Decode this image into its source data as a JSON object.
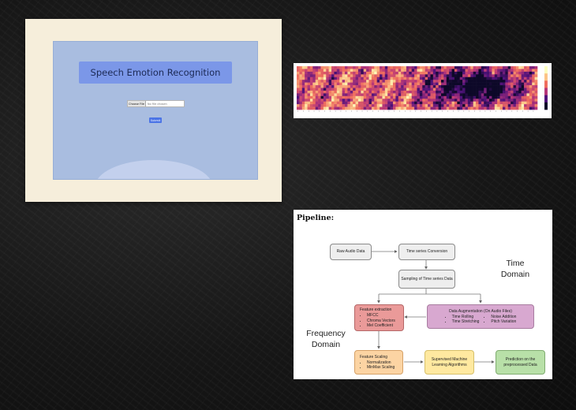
{
  "app_screenshot": {
    "title": "Speech Emotion Recognition",
    "file_button_label": "Choose File",
    "file_status": "No file chosen",
    "submit_label": "Submit",
    "colors": {
      "card_bg": "#f6eedb",
      "screen_bg": "#a9bde0",
      "title_bg": "#7b97e8",
      "button_bg": "#4b74e6"
    }
  },
  "heatmap": {
    "colormap": "magma",
    "colorbar": true
  },
  "pipeline": {
    "title": "Pipeline:",
    "nodes": {
      "raw_audio": "Raw Audio Data",
      "time_series": "Time series Conversion",
      "sampling": "Sampling of Time series Data",
      "feature_extraction": {
        "title": "Feature extraction",
        "items": [
          "MFCC",
          "Chroma Vectors",
          "Mel Coefficient"
        ]
      },
      "augmentation": {
        "title": "Data Augmentation (On Audio Files)",
        "items_left": [
          "Time Rolling",
          "Time Stretching"
        ],
        "items_right": [
          "Noise Addition",
          "Pitch Variation"
        ]
      },
      "feature_scaling": {
        "title": "Feature Scaling",
        "items": [
          "Normalization",
          "MinMax Scaling"
        ]
      },
      "supervised": "Supervised Machine Learning Algorithms",
      "prediction": "Prediction on the preprocessed Data"
    },
    "time_domain_label": [
      "Time",
      "Domain"
    ],
    "frequency_domain_label": [
      "Frequency",
      "Domain"
    ]
  }
}
